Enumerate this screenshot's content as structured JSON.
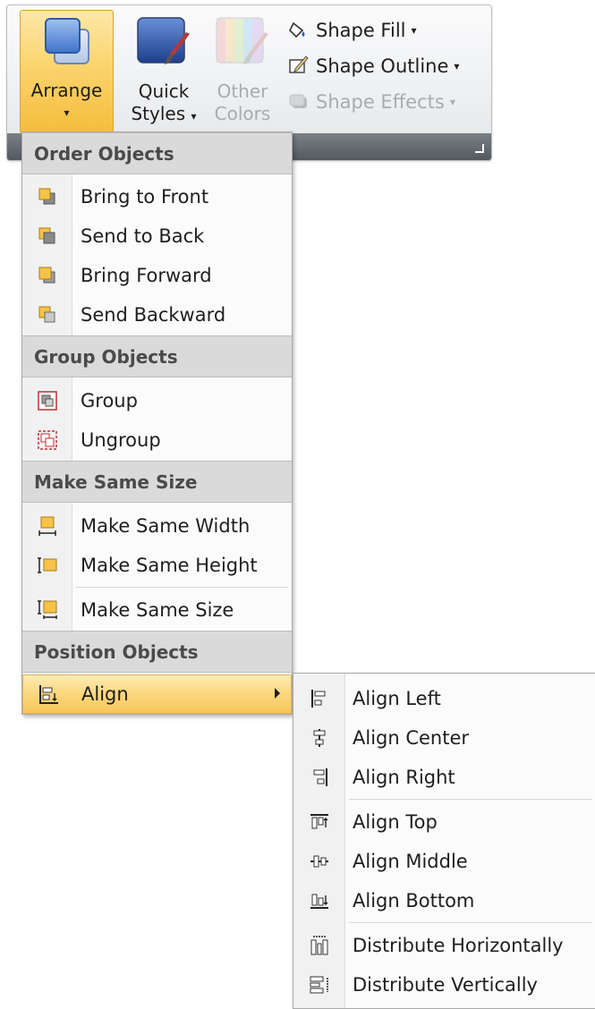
{
  "ribbon": {
    "arrange": {
      "label": "Arrange",
      "caret": "▾"
    },
    "quick_styles": {
      "line1": "Quick",
      "line2": "Styles",
      "caret": "▾"
    },
    "other_colors": {
      "line1": "Other",
      "line2": "Colors"
    },
    "shape_fill": {
      "label": "Shape Fill",
      "caret": "▾"
    },
    "shape_outline": {
      "label": "Shape Outline",
      "caret": "▾"
    },
    "shape_effects": {
      "label": "Shape Effects",
      "caret": "▾"
    }
  },
  "arrange_menu": {
    "order_header": "Order Objects",
    "bring_to_front": "Bring to Front",
    "send_to_back": "Send to Back",
    "bring_forward": "Bring Forward",
    "send_backward": "Send Backward",
    "group_header": "Group Objects",
    "group": "Group",
    "ungroup": "Ungroup",
    "size_header": "Make Same Size",
    "same_width": "Make Same Width",
    "same_height": "Make Same Height",
    "same_size": "Make Same Size",
    "position_header": "Position Objects",
    "align": "Align"
  },
  "align_menu": {
    "align_left": "Align Left",
    "align_center": "Align Center",
    "align_right": "Align Right",
    "align_top": "Align Top",
    "align_middle": "Align Middle",
    "align_bottom": "Align Bottom",
    "distribute_horizontally": "Distribute Horizontally",
    "distribute_vertically": "Distribute Vertically"
  },
  "colors": {
    "highlight": "#f8c65a",
    "header": "#dadada",
    "accent_blue": "#2f59b8"
  }
}
